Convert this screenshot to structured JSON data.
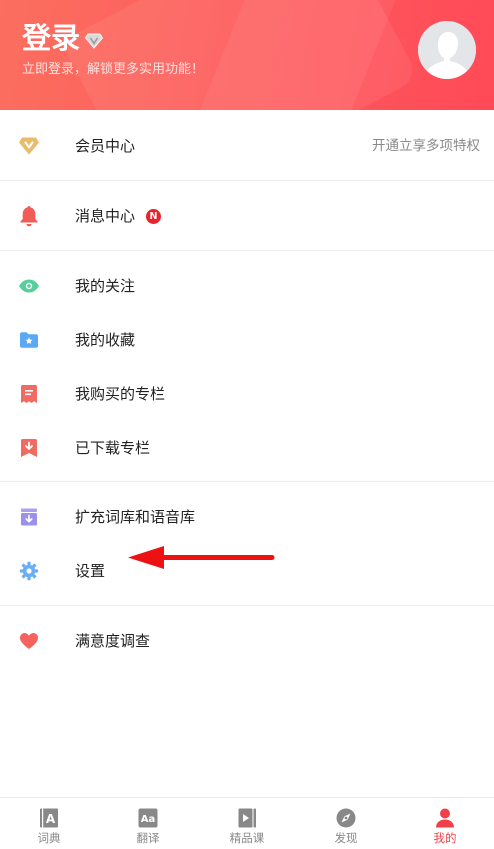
{
  "header": {
    "title": "登录",
    "subtitle": "立即登录，解锁更多实用功能！"
  },
  "menu": {
    "membership": {
      "label": "会员中心",
      "hint": "开通立享多项特权"
    },
    "messages": {
      "label": "消息中心",
      "badge": "N"
    },
    "following": {
      "label": "我的关注"
    },
    "favorites": {
      "label": "我的收藏"
    },
    "purchased": {
      "label": "我购买的专栏"
    },
    "downloaded": {
      "label": "已下载专栏"
    },
    "expand_library": {
      "label": "扩充词库和语音库"
    },
    "settings": {
      "label": "设置"
    },
    "survey": {
      "label": "满意度调查"
    }
  },
  "tabbar": {
    "tabs": [
      {
        "label": "词典",
        "icon": "dictionary-icon",
        "active": false
      },
      {
        "label": "翻译",
        "icon": "translate-icon",
        "active": false
      },
      {
        "label": "精品课",
        "icon": "course-icon",
        "active": false
      },
      {
        "label": "发现",
        "icon": "discover-compass-icon",
        "active": false
      },
      {
        "label": "我的",
        "icon": "profile-icon",
        "active": true
      }
    ]
  },
  "colors": {
    "header_gradient_start": "#fb6f5f",
    "header_gradient_end": "#ff4a58",
    "active_tab": "#f0414b",
    "badge": "#e8232b",
    "annotation_arrow": "#ee1111"
  }
}
